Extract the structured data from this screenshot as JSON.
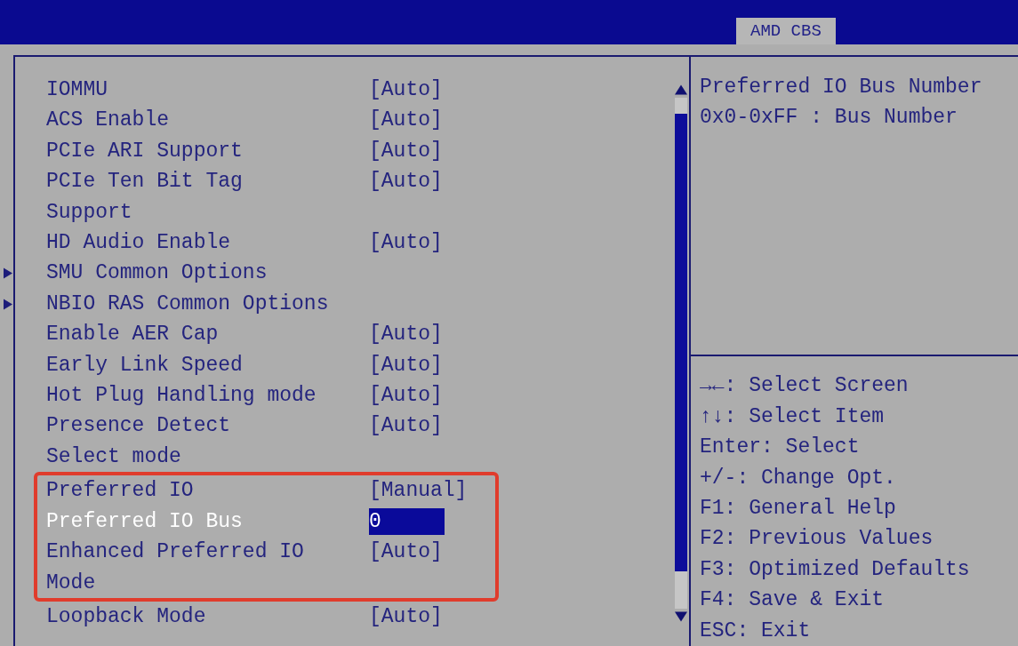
{
  "top_bar": {
    "tabs": [
      {
        "label": "AMD CBS",
        "selected": true
      }
    ]
  },
  "settings": [
    {
      "kind": "setting",
      "label": "IOMMU",
      "value": "[Auto]",
      "selected": false,
      "highlighted": false
    },
    {
      "kind": "setting",
      "label": "ACS Enable",
      "value": "[Auto]",
      "selected": false,
      "highlighted": false
    },
    {
      "kind": "setting",
      "label": "PCIe ARI Support",
      "value": "[Auto]",
      "selected": false,
      "highlighted": false
    },
    {
      "kind": "setting",
      "label": "PCIe Ten Bit Tag\nSupport",
      "value": "[Auto]",
      "selected": false,
      "highlighted": false
    },
    {
      "kind": "setting",
      "label": "HD Audio Enable",
      "value": "[Auto]",
      "selected": false,
      "highlighted": false
    },
    {
      "kind": "submenu",
      "label": "SMU Common Options",
      "selected": false,
      "highlighted": false
    },
    {
      "kind": "submenu",
      "label": "NBIO RAS Common Options",
      "selected": false,
      "highlighted": false
    },
    {
      "kind": "setting",
      "label": "Enable AER Cap",
      "value": "[Auto]",
      "selected": false,
      "highlighted": false
    },
    {
      "kind": "setting",
      "label": "Early Link Speed",
      "value": "[Auto]",
      "selected": false,
      "highlighted": false
    },
    {
      "kind": "setting",
      "label": "Hot Plug Handling mode",
      "value": "[Auto]",
      "selected": false,
      "highlighted": false
    },
    {
      "kind": "setting",
      "label": "Presence Detect\nSelect mode",
      "value": "[Auto]",
      "selected": false,
      "highlighted": false
    },
    {
      "kind": "setting",
      "label": "Preferred IO",
      "value": "[Manual]",
      "selected": false,
      "highlighted": true
    },
    {
      "kind": "input",
      "label": "Preferred IO Bus",
      "value": "0",
      "selected": true,
      "highlighted": true
    },
    {
      "kind": "setting",
      "label": "Enhanced Preferred IO\nMode",
      "value": "[Auto]",
      "selected": false,
      "highlighted": true
    },
    {
      "kind": "setting",
      "label": "Loopback Mode",
      "value": "[Auto]",
      "selected": false,
      "highlighted": false
    }
  ],
  "help": {
    "lines": [
      "Preferred IO Bus Number",
      "0x0-0xFF : Bus Number"
    ]
  },
  "key_hints": [
    "→←: Select Screen",
    "↑↓: Select Item",
    "Enter: Select",
    "+/-: Change Opt.",
    "F1: General Help",
    "F2: Previous Values",
    "F3: Optimized Defaults",
    "F4: Save & Exit",
    "ESC: Exit"
  ]
}
